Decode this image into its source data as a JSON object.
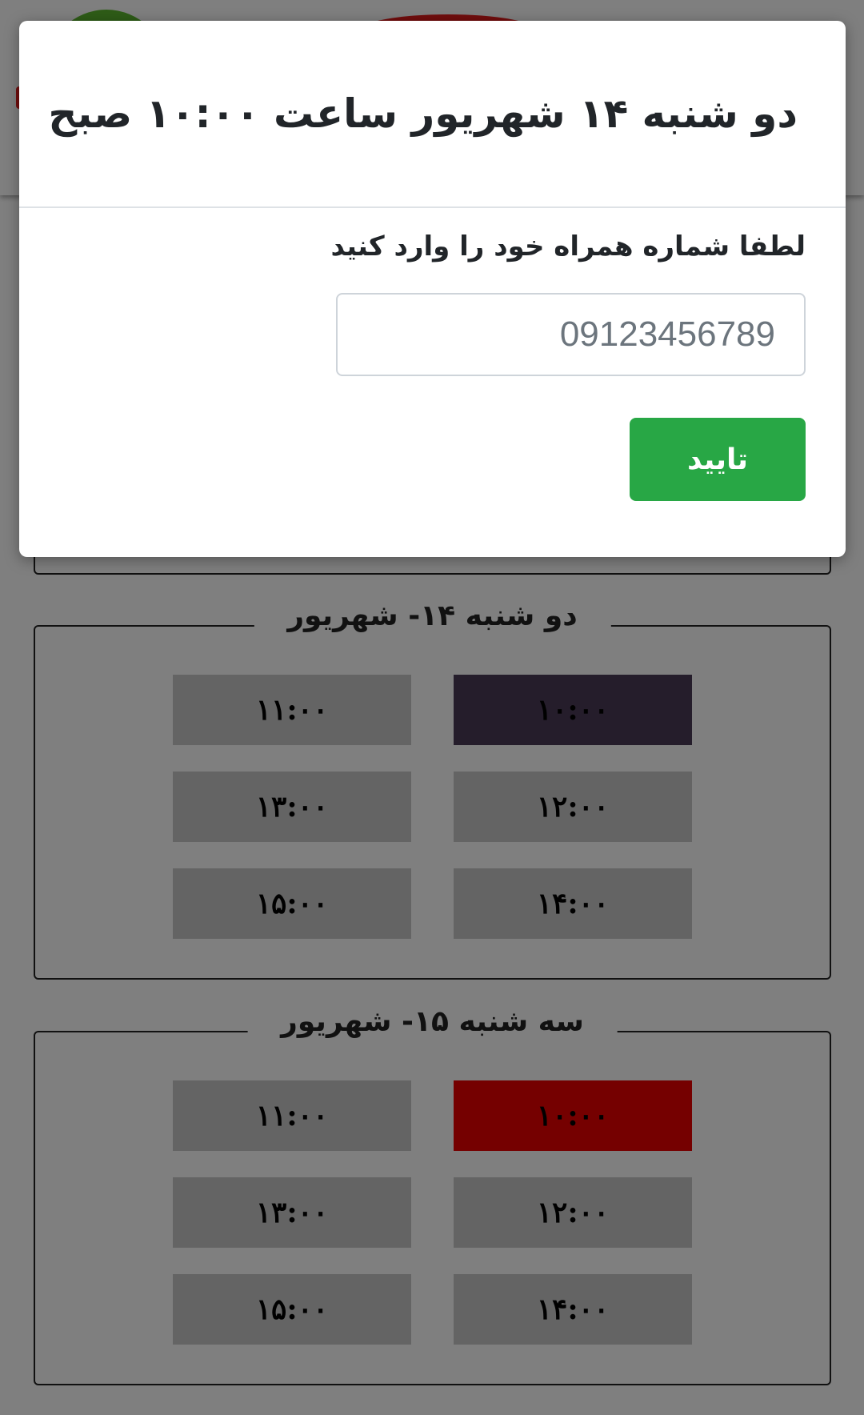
{
  "days": [
    {
      "label": "دو شنبه ۱۴- شهریور",
      "slots": [
        "۱۱:۰۰",
        "۱۰:۰۰",
        "۱۳:۰۰",
        "۱۲:۰۰",
        "۱۵:۰۰",
        "۱۴:۰۰"
      ],
      "highlight_color": "#4a3a56"
    },
    {
      "label": "سه شنبه ۱۵- شهریور",
      "slots": [
        "۱۱:۰۰",
        "۱۰:۰۰",
        "۱۳:۰۰",
        "۱۲:۰۰",
        "۱۵:۰۰",
        "۱۴:۰۰"
      ],
      "highlight_color": "#ea0000"
    }
  ],
  "modal": {
    "title": "دو شنبه ۱۴ شهریور ساعت ۱۰:۰۰ صبح",
    "prompt": "لطفا شماره همراه خود را وارد کنید",
    "phone_placeholder": "09123456789",
    "confirm_label": "تایید"
  },
  "colors": {
    "overlay": "rgba(0,0,0,0.5)",
    "confirm_button": "#28a745",
    "slot_default": "#c8c8c8",
    "logo_green": "#5cb82f",
    "logo_red": "#e21b1b"
  },
  "icons": [
    "logo-mark"
  ]
}
